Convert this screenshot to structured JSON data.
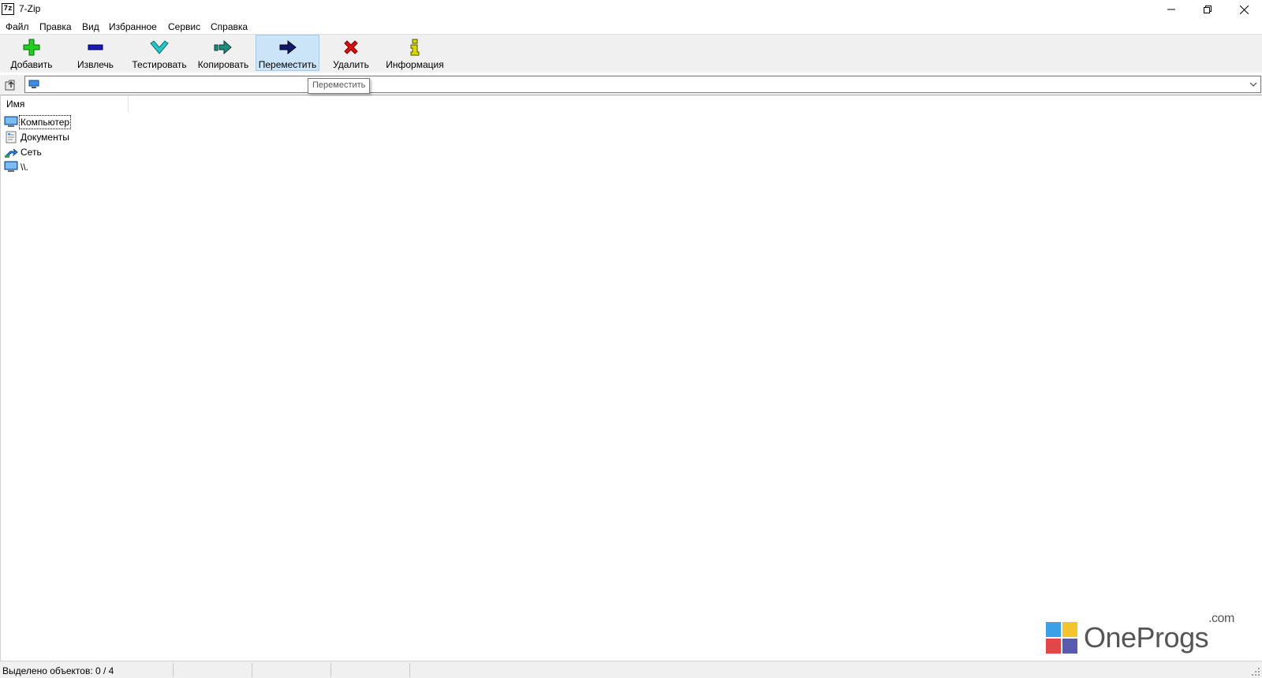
{
  "window": {
    "title": "7-Zip",
    "app_icon_text": "7z"
  },
  "menu": [
    {
      "label": "Файл"
    },
    {
      "label": "Правка"
    },
    {
      "label": "Вид"
    },
    {
      "label": "Избранное"
    },
    {
      "label": "Сервис"
    },
    {
      "label": "Справка"
    }
  ],
  "toolbar": {
    "buttons": [
      {
        "label": "Добавить",
        "icon": "plus-icon",
        "color": "#1fcf1f"
      },
      {
        "label": "Извлечь",
        "icon": "minus-icon",
        "color": "#1a1ab8"
      },
      {
        "label": "Тестировать",
        "icon": "check-icon",
        "color": "#26c6c6"
      },
      {
        "label": "Копировать",
        "icon": "copy-arrow-icon",
        "color": "#1e8c7e"
      },
      {
        "label": "Переместить",
        "icon": "arrow-right-icon",
        "color": "#111a66"
      },
      {
        "label": "Удалить",
        "icon": "x-icon",
        "color": "#e01010"
      },
      {
        "label": "Информация",
        "icon": "info-icon",
        "color": "#d8d800"
      }
    ],
    "hovered": "Переместить"
  },
  "tooltip": {
    "text": "Переместить"
  },
  "address": {
    "value": ""
  },
  "list": {
    "column_name": "Имя",
    "items": [
      {
        "label": "Компьютер",
        "icon": "computer-icon"
      },
      {
        "label": "Документы",
        "icon": "documents-icon"
      },
      {
        "label": "Сеть",
        "icon": "network-icon"
      },
      {
        "label": "\\\\.",
        "icon": "computer-icon"
      }
    ]
  },
  "watermark": {
    "brand": "OneProgs",
    "suffix": ".com"
  },
  "status": {
    "selected": "Выделено объектов: 0 / 4"
  }
}
